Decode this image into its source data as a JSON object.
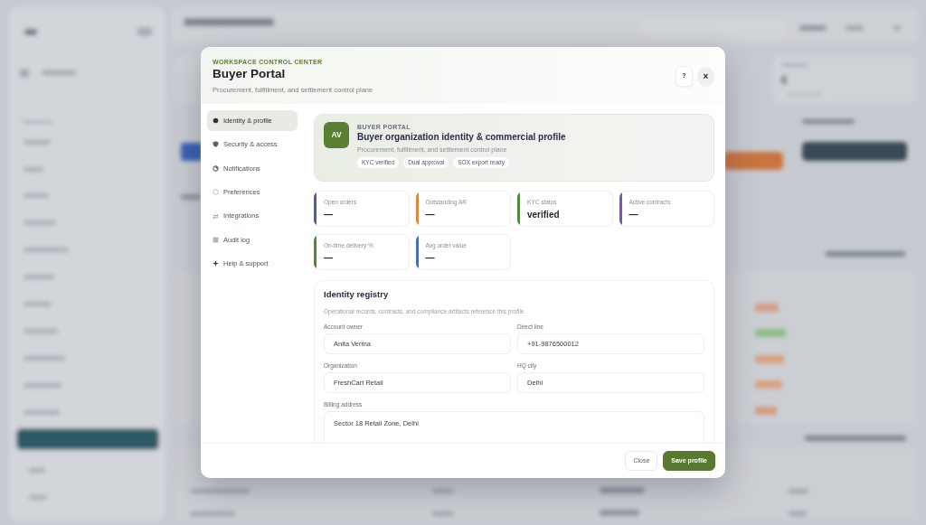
{
  "modal": {
    "eyebrow": "WORKSPACE CONTROL CENTER",
    "title": "Buyer Portal",
    "subtitle": "Procurement, fulfillment, and settlement control plane",
    "help_button": "?",
    "close_button": "×"
  },
  "sidebar": {
    "items": [
      {
        "label": "Identity & profile",
        "selected": true
      },
      {
        "label": "Security & access",
        "selected": false
      },
      {
        "label": "Notifications",
        "selected": false
      },
      {
        "label": "Preferences",
        "selected": false
      },
      {
        "label": "Integrations",
        "selected": false
      },
      {
        "label": "Audit log",
        "selected": false
      },
      {
        "label": "Help & support",
        "selected": false
      }
    ]
  },
  "profile_card": {
    "avatar": "AV",
    "eyebrow": "BUYER PORTAL",
    "title": "Buyer organization identity & commercial profile",
    "subtitle": "Procurement, fulfillment, and settlement control plane",
    "tags": [
      "KYC verified",
      "Dual approval",
      "SOX export ready"
    ]
  },
  "stats": [
    {
      "label": "Open orders",
      "value": "—",
      "color": "#4a5bb0"
    },
    {
      "label": "Outstanding AR",
      "value": "—",
      "color": "#d98b3a"
    },
    {
      "label": "KYC status",
      "value": "verified",
      "color": "#4f8a3c"
    },
    {
      "label": "Active contracts",
      "value": "—",
      "color": "#7b55b5"
    },
    {
      "label": "On-time delivery %",
      "value": "—",
      "color": "#4f8a3c"
    },
    {
      "label": "Avg order value",
      "value": "—",
      "color": "#4a6fb0"
    }
  ],
  "identity_registry": {
    "title": "Identity registry",
    "description": "Operational records, contracts, and compliance artifacts reference this profile",
    "fields": [
      {
        "label": "Account owner",
        "value": "Anita Verma",
        "kind": "input"
      },
      {
        "label": "Direct line",
        "value": "+91-9876500012",
        "kind": "input"
      },
      {
        "label": "Organization",
        "value": "FreshCart Retail",
        "kind": "input"
      },
      {
        "label": "HQ city",
        "value": "Delhi",
        "kind": "input"
      },
      {
        "label": "Billing address",
        "value": "Sector 18 Retail Zone, Delhi",
        "kind": "textarea"
      }
    ]
  },
  "footer": {
    "buttons": [
      {
        "label": "Close",
        "kind": "secondary"
      },
      {
        "label": "Save profile",
        "kind": "primary"
      }
    ]
  }
}
